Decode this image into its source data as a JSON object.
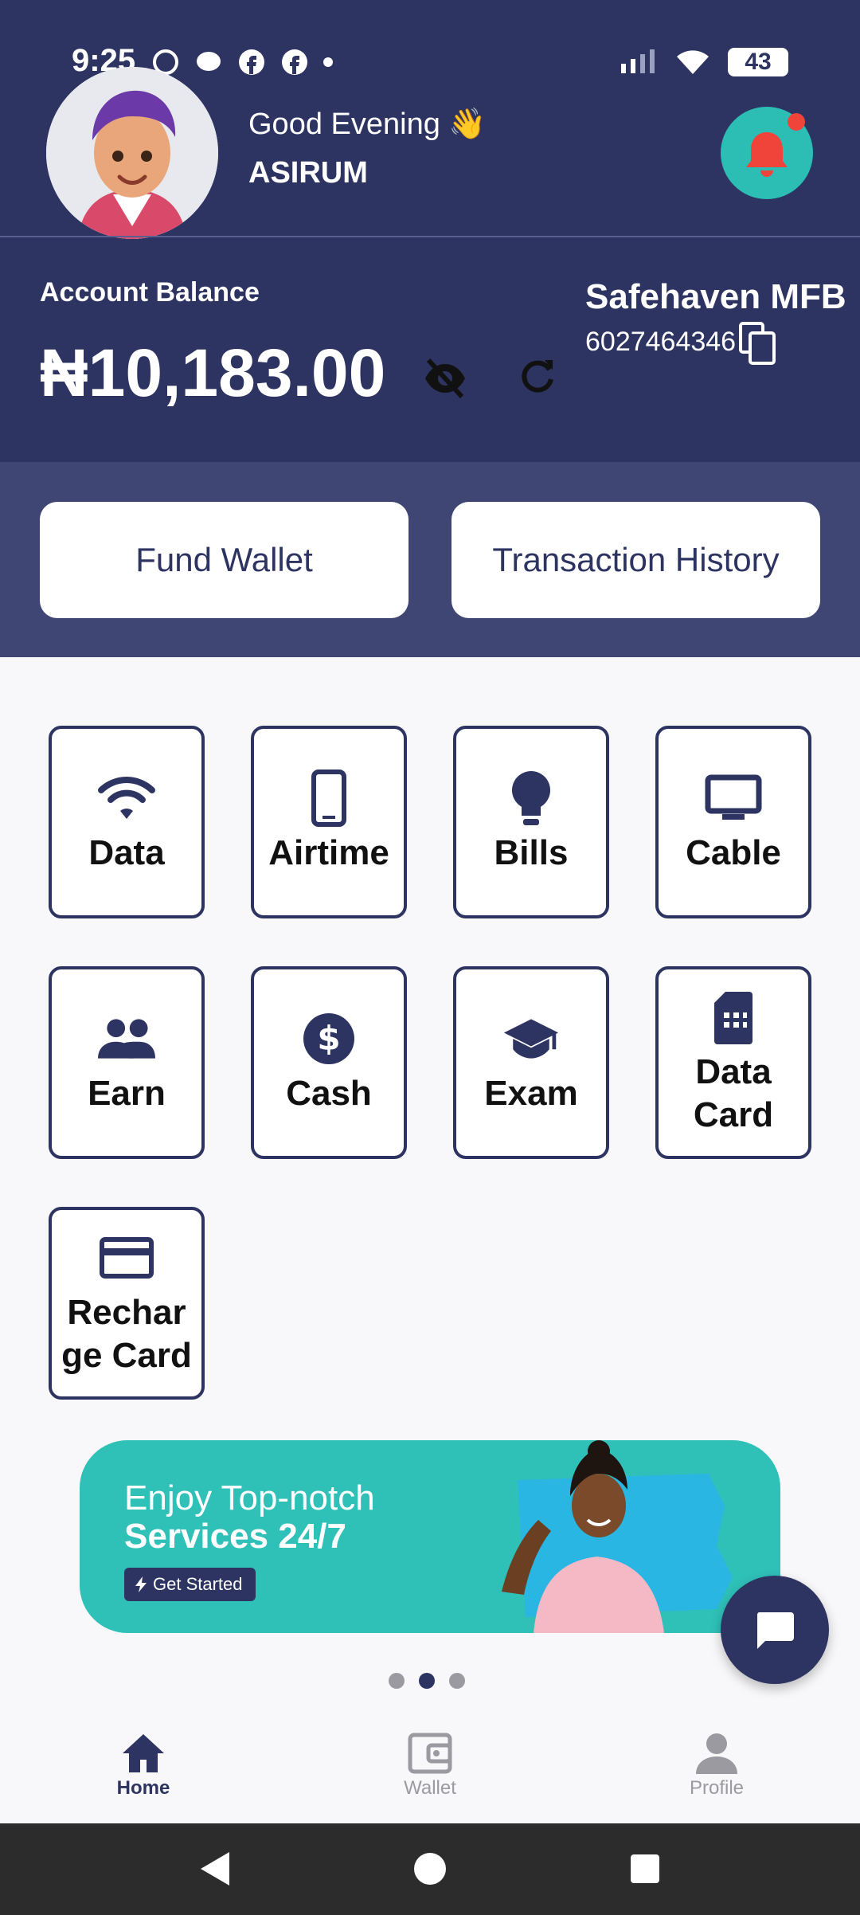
{
  "status_bar": {
    "time": "9:25",
    "battery": "43"
  },
  "header": {
    "greeting": "Good Evening 👋",
    "username": "ASIRUM"
  },
  "account": {
    "balance_label": "Account Balance",
    "balance": "₦10,183.00",
    "bank_name": "Safehaven MFB",
    "account_number": "6027464346"
  },
  "actions": {
    "fund_wallet": "Fund Wallet",
    "transaction_history": "Transaction History"
  },
  "services": [
    {
      "label": "Data",
      "icon": "wifi-icon"
    },
    {
      "label": "Airtime",
      "icon": "phone-icon"
    },
    {
      "label": "Bills",
      "icon": "bulb-icon"
    },
    {
      "label": "Cable",
      "icon": "tv-icon"
    },
    {
      "label": "Earn",
      "icon": "people-icon"
    },
    {
      "label": "Cash",
      "icon": "dollar-icon"
    },
    {
      "label": "Exam",
      "icon": "graduation-cap-icon"
    },
    {
      "label": "Data Card",
      "icon": "sim-card-icon"
    },
    {
      "label": "Recharge Card",
      "icon": "credit-card-icon"
    }
  ],
  "banner": {
    "line1": "Enjoy Top-notch",
    "line2": "Services 24/7",
    "cta": "Get Started"
  },
  "carousel": {
    "count": 3,
    "active": 2
  },
  "bottom_nav": [
    {
      "label": "Home",
      "icon": "home-icon",
      "active": true
    },
    {
      "label": "Wallet",
      "icon": "wallet-icon",
      "active": false
    },
    {
      "label": "Profile",
      "icon": "person-icon",
      "active": false
    }
  ],
  "colors": {
    "primary": "#2e3462",
    "accent": "#2cbdb4",
    "notification": "#f0443a"
  }
}
